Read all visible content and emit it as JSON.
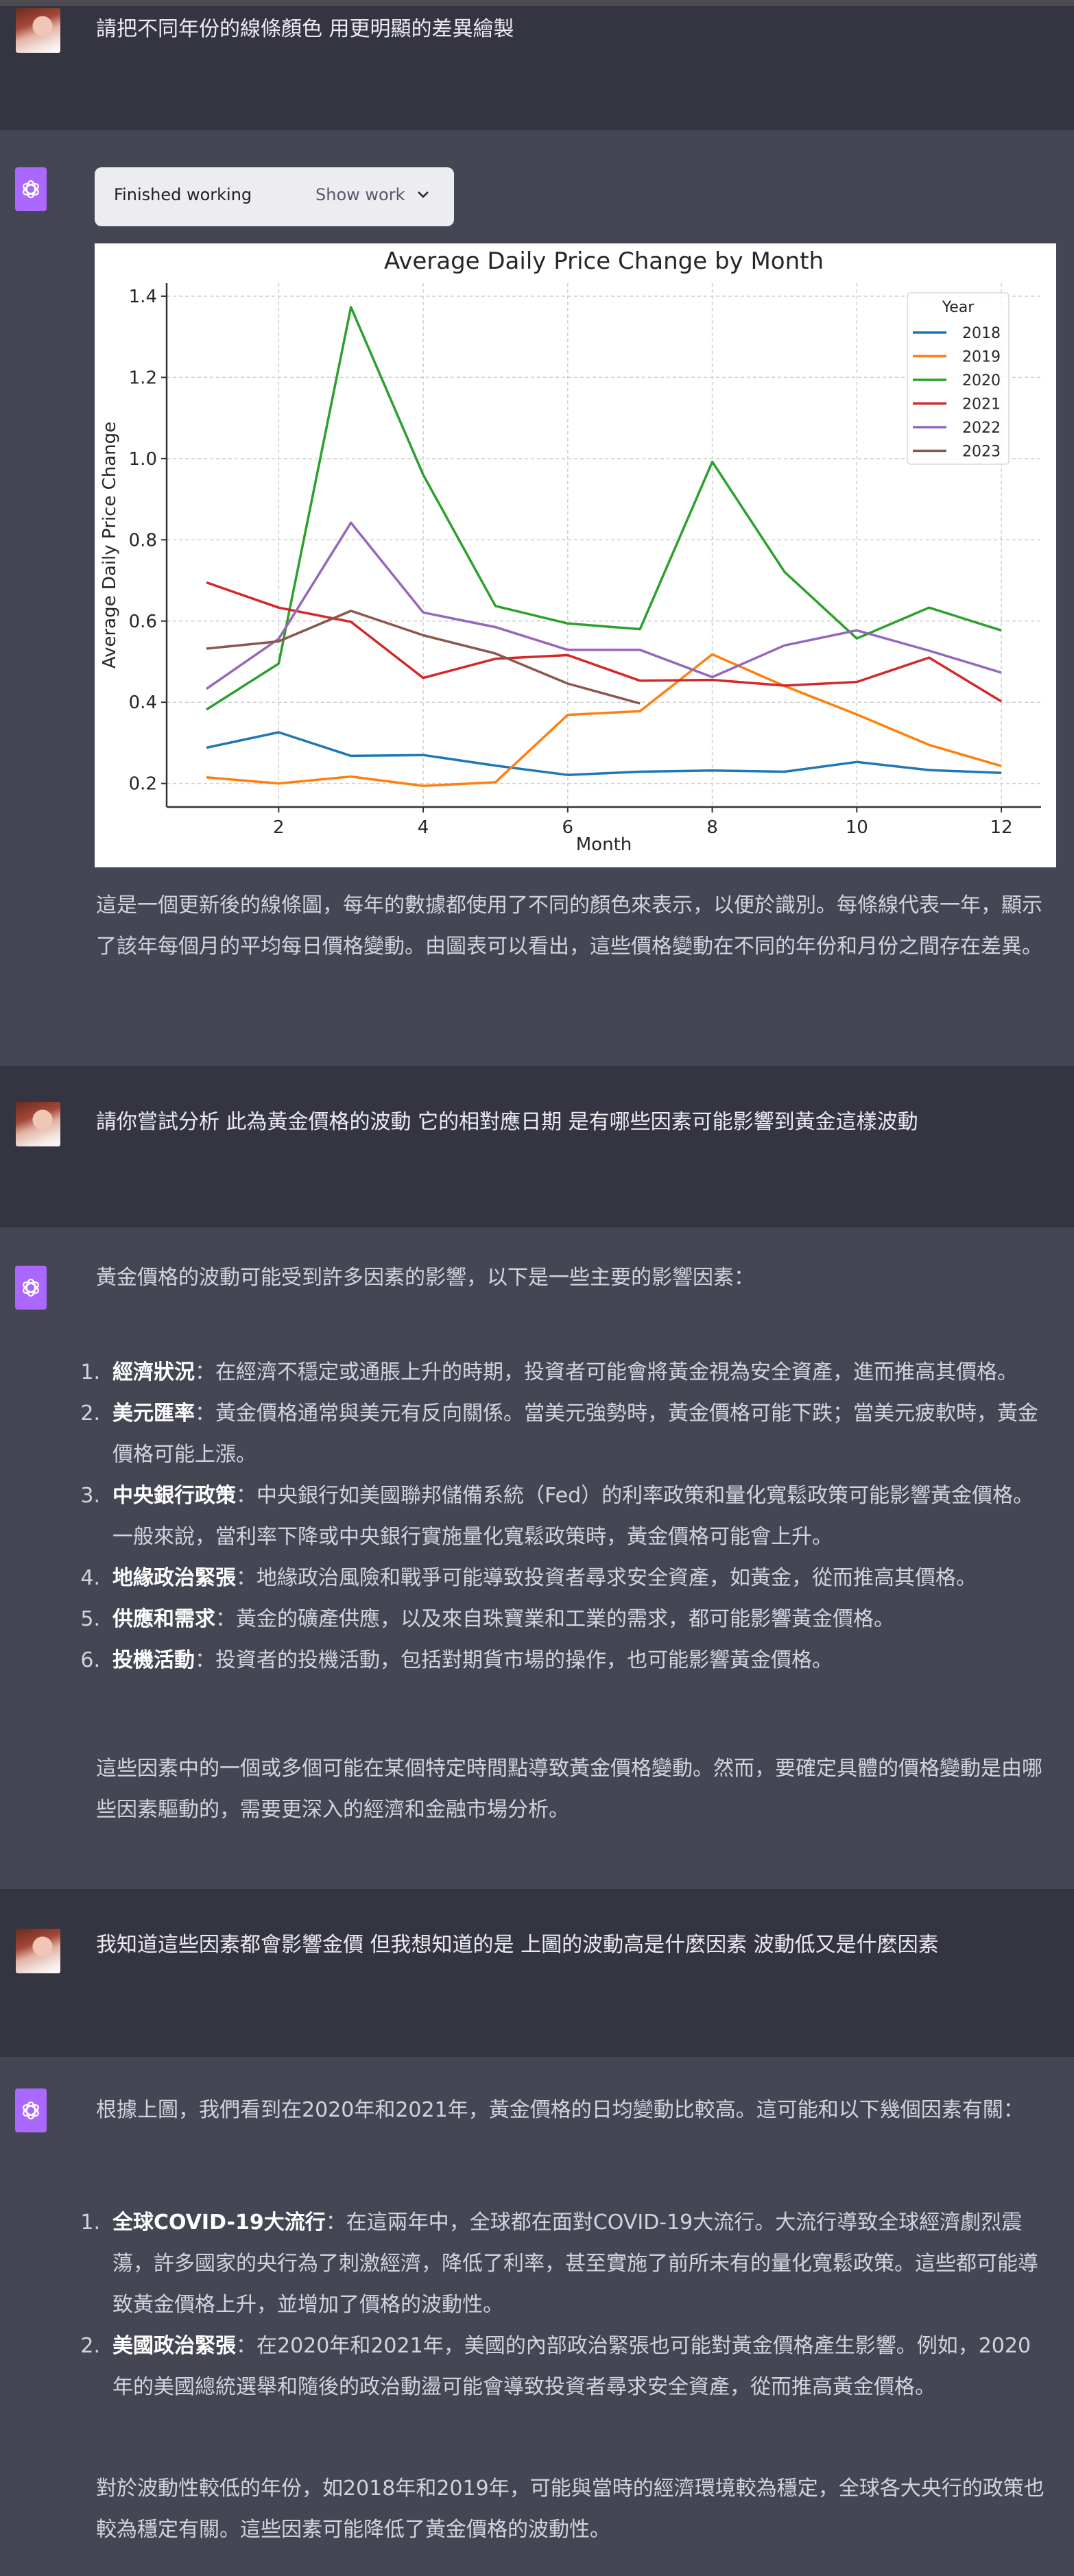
{
  "conversation": [
    {
      "role": "user",
      "text": "請把不同年份的線條顏色 用更明顯的差異繪製"
    },
    {
      "role": "assistant",
      "tool_status": {
        "label": "Finished working",
        "toggle": "Show work",
        "icon": "chevron-down-icon"
      },
      "paragraph": "這是一個更新後的線條圖，每年的數據都使用了不同的顏色來表示，以便於識別。每條線代表一年，顯示了該年每個月的平均每日價格變動。由圖表可以看出，這些價格變動在不同的年份和月份之間存在差異。"
    },
    {
      "role": "user",
      "text": "請你嘗試分析 此為黃金價格的波動 它的相對應日期 是有哪些因素可能影響到黃金這樣波動"
    },
    {
      "role": "assistant",
      "intro": "黃金價格的波動可能受到許多因素的影響，以下是一些主要的影響因素：",
      "items": [
        {
          "num": "1.",
          "title": "經濟狀況",
          "text": "：在經濟不穩定或通脹上升的時期，投資者可能會將黃金視為安全資產，進而推高其價格。"
        },
        {
          "num": "2.",
          "title": "美元匯率",
          "text": "：黃金價格通常與美元有反向關係。當美元強勢時，黃金價格可能下跌；當美元疲軟時，黃金價格可能上漲。"
        },
        {
          "num": "3.",
          "title": "中央銀行政策",
          "text": "：中央銀行如美國聯邦儲備系統（Fed）的利率政策和量化寬鬆政策可能影響黃金價格。一般來說，當利率下降或中央銀行實施量化寬鬆政策時，黃金價格可能會上升。"
        },
        {
          "num": "4.",
          "title": "地緣政治緊張",
          "text": "：地緣政治風險和戰爭可能導致投資者尋求安全資產，如黃金，從而推高其價格。"
        },
        {
          "num": "5.",
          "title": "供應和需求",
          "text": "：黃金的礦產供應，以及來自珠寶業和工業的需求，都可能影響黃金價格。"
        },
        {
          "num": "6.",
          "title": "投機活動",
          "text": "：投資者的投機活動，包括對期貨市場的操作，也可能影響黃金價格。"
        }
      ],
      "outro": "這些因素中的一個或多個可能在某個特定時間點導致黃金價格變動。然而，要確定具體的價格變動是由哪些因素驅動的，需要更深入的經濟和金融市場分析。"
    },
    {
      "role": "user",
      "text": "我知道這些因素都會影響金價 但我想知道的是 上圖的波動高是什麼因素 波動低又是什麼因素"
    },
    {
      "role": "assistant",
      "intro": "根據上圖，我們看到在2020年和2021年，黃金價格的日均變動比較高。這可能和以下幾個因素有關：",
      "items": [
        {
          "num": "1.",
          "title": "全球COVID-19大流行",
          "text": "：在這兩年中，全球都在面對COVID-19大流行。大流行導致全球經濟劇烈震蕩，許多國家的央行為了刺激經濟，降低了利率，甚至實施了前所未有的量化寬鬆政策。這些都可能導致黃金價格上升，並增加了價格的波動性。"
        },
        {
          "num": "2.",
          "title": "美國政治緊張",
          "text": "：在2020年和2021年，美國的內部政治緊張也可能對黃金價格產生影響。例如，2020年的美國總統選舉和隨後的政治動盪可能會導致投資者尋求安全資產，從而推高黃金價格。"
        }
      ],
      "outro": "對於波動性較低的年份，如2018年和2019年，可能與當時的經濟環境較為穩定，全球各大央行的政策也較為穩定有關。這些因素可能降低了黃金價格的波動性。"
    }
  ],
  "chart_data": {
    "type": "line",
    "title": "Average Daily Price Change by Month",
    "xlabel": "Month",
    "ylabel": "Average Daily Price Change",
    "x": [
      1,
      2,
      3,
      4,
      5,
      6,
      7,
      8,
      9,
      10,
      11,
      12
    ],
    "xticks": [
      2,
      4,
      6,
      8,
      10,
      12
    ],
    "yticks": [
      0.2,
      0.4,
      0.6,
      0.8,
      1.0,
      1.2,
      1.4
    ],
    "xlim": [
      0.45,
      12.55
    ],
    "ylim": [
      0.142,
      1.432
    ],
    "grid": true,
    "legend": {
      "title": "Year",
      "position": "top-right"
    },
    "series": [
      {
        "name": "2018",
        "color": "#1f77b4",
        "values": [
          0.288,
          0.326,
          0.268,
          0.27,
          0.244,
          0.221,
          0.229,
          0.232,
          0.229,
          0.253,
          0.233,
          0.226
        ]
      },
      {
        "name": "2019",
        "color": "#ff7f0e",
        "values": [
          0.215,
          0.2,
          0.217,
          0.194,
          0.203,
          0.369,
          0.378,
          0.518,
          0.44,
          0.37,
          0.295,
          0.243
        ]
      },
      {
        "name": "2020",
        "color": "#2ca02c",
        "values": [
          0.382,
          0.495,
          1.373,
          0.96,
          0.637,
          0.594,
          0.58,
          0.992,
          0.721,
          0.557,
          0.633,
          0.577
        ]
      },
      {
        "name": "2021",
        "color": "#d62728",
        "values": [
          0.695,
          0.633,
          0.598,
          0.46,
          0.507,
          0.516,
          0.453,
          0.455,
          0.441,
          0.45,
          0.51,
          0.402
        ]
      },
      {
        "name": "2022",
        "color": "#9467bd",
        "values": [
          0.433,
          0.556,
          0.842,
          0.621,
          0.585,
          0.529,
          0.529,
          0.462,
          0.54,
          0.577,
          0.527,
          0.473
        ]
      },
      {
        "name": "2023",
        "color": "#8c564b",
        "values": [
          0.532,
          0.55,
          0.625,
          0.565,
          0.52,
          0.446,
          0.397,
          null,
          null,
          null,
          null,
          null
        ]
      }
    ]
  }
}
